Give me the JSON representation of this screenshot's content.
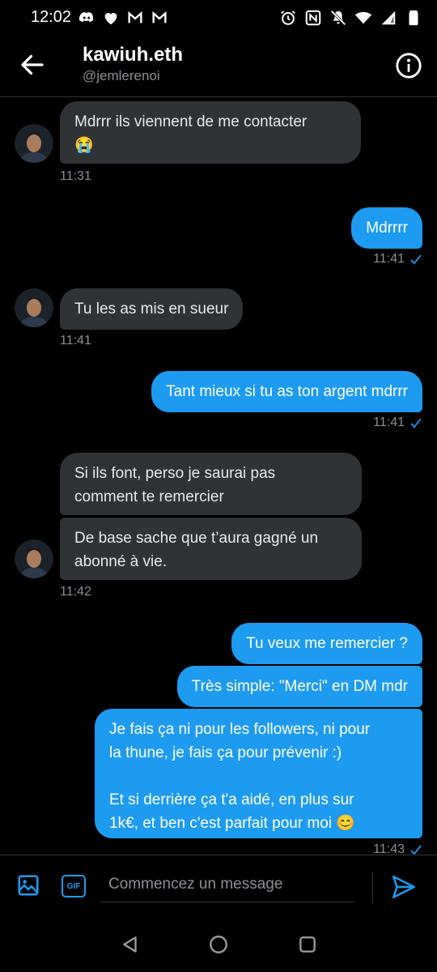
{
  "status_bar": {
    "time": "12:02",
    "left_icons": [
      "discord-icon",
      "heart-icon",
      "gmail-icon",
      "gmail-icon"
    ],
    "right_icons": [
      "alarm-icon",
      "nfc-icon",
      "mute-icon",
      "wifi-icon",
      "signal-icon",
      "battery-icon"
    ]
  },
  "header": {
    "name": "kawiuh.eth",
    "handle": "@jemlerenoi"
  },
  "messages": [
    {
      "sender": "them",
      "text": "Mdrrr ils viennent de me contacter\n😭"
    },
    {
      "sender": "them",
      "time": "11:31"
    },
    {
      "sender": "me",
      "text": "Mdrrrr"
    },
    {
      "sender": "me",
      "time": "11:41"
    },
    {
      "sender": "them",
      "text": "Tu les as mis en sueur"
    },
    {
      "sender": "them",
      "time": "11:41"
    },
    {
      "sender": "me",
      "text": "Tant mieux si tu as ton argent mdrrr"
    },
    {
      "sender": "me",
      "time": "11:41"
    },
    {
      "sender": "them",
      "text": "Si ils font, perso je saurai pas\ncomment te remercier"
    },
    {
      "sender": "them",
      "text": "De base sache que t’aura gagné un\nabonné à vie."
    },
    {
      "sender": "them",
      "time": "11:42"
    },
    {
      "sender": "me",
      "text": "Tu veux me remercier ?"
    },
    {
      "sender": "me",
      "text": "Très simple: \"Merci\" en DM mdr"
    },
    {
      "sender": "me",
      "text": "Je fais ça ni pour les followers, ni pour\nla thune, je fais ça pour prévenir :)\n\nEt si derrière ça t'a aidé, en plus sur\n1k€, et ben c'est parfait pour moi 😊"
    },
    {
      "sender": "me",
      "time": "11:43"
    }
  ],
  "composer": {
    "placeholder": "Commencez un message",
    "gif_label": "GIF"
  },
  "colors": {
    "accent": "#1d9bf0",
    "incoming_bubble": "#2f3336",
    "background": "#000000"
  }
}
